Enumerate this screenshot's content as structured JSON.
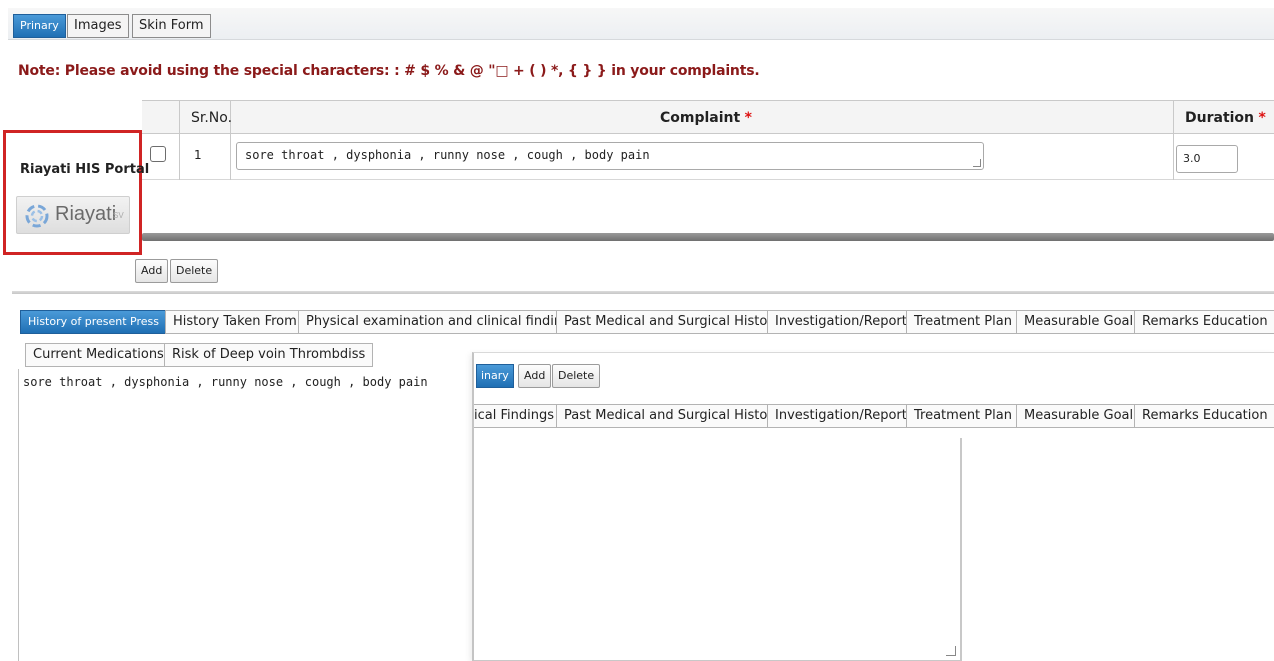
{
  "top_tabs": [
    {
      "label": "Prinary",
      "active": true
    },
    {
      "label": "Images",
      "active": false
    },
    {
      "label": "Skin Form",
      "active": false
    }
  ],
  "note": "Note: Please avoid using the special characters: : # $ % & @ \"□ + ( ) *, { } } in your complaints.",
  "grid": {
    "col_srno": "Sr.No.",
    "col_complaint": "Complaint",
    "col_duration": "Duration",
    "required_mark": "*",
    "row": {
      "srno": "1",
      "complaint": "sore throat , dysphonia , runny nose , cough , body pain",
      "duration": "3.0"
    }
  },
  "portal": {
    "label": "Riayati HIS Portal",
    "logo_text": "Riayati",
    "logo_sub": "SV"
  },
  "actions": {
    "add": "Add",
    "delete": "Delete"
  },
  "bottom_tabs_row1": [
    "History of present Press",
    "History Taken From",
    "Physical examination and clinical findings",
    "Past Medical and Surgical History",
    "Investigation/Report",
    "Treatment Plan",
    "Measurable Goal",
    "Remarks Education"
  ],
  "bottom_tabs_row2": [
    "Current Medications",
    "Risk of Deep voin Thrombdiss"
  ],
  "history_text": "sore throat , dysphonia , runny nose , cough , body pain",
  "overlay": {
    "tab_active": "inary",
    "add": "Add",
    "delete": "Delete",
    "tabs": [
      "ical Findings",
      "Past Medical and Surgical History",
      "Investigation/Report",
      "Treatment Plan",
      "Measurable Goal",
      "Remarks Education"
    ]
  },
  "colors": {
    "accent": "#2a7fc4",
    "note": "#8b1a1a",
    "highlight": "#d02424"
  }
}
